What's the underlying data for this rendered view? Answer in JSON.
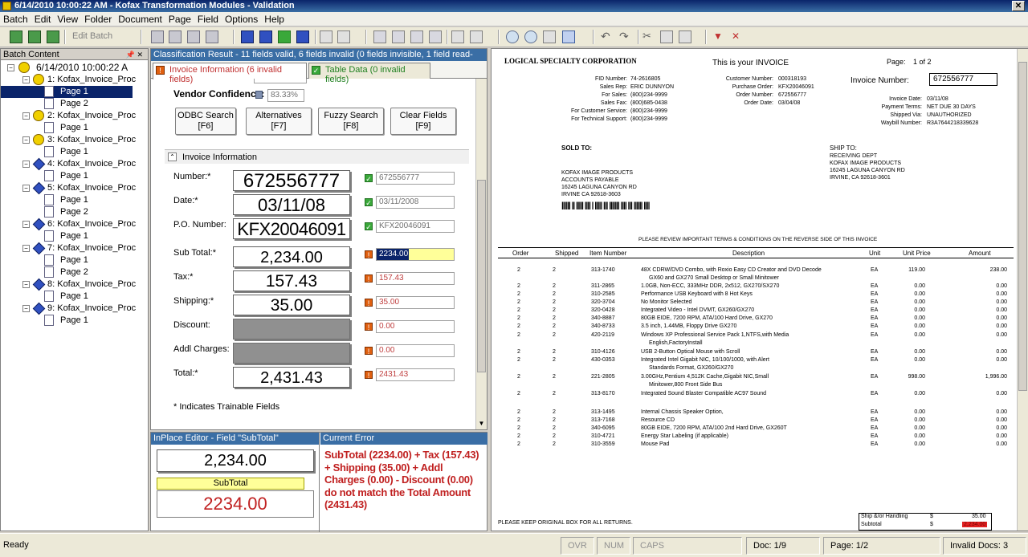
{
  "window": {
    "title": "6/14/2010 10:00:22 AM - Kofax Transformation Modules - Validation",
    "close": "✕"
  },
  "menu": [
    "Batch",
    "Edit",
    "View",
    "Folder",
    "Document",
    "Page",
    "Field",
    "Options",
    "Help"
  ],
  "toolbar": {
    "edit_batch": "Edit Batch"
  },
  "batch": {
    "title": "Batch Content",
    "pin": "📌 ✕",
    "root": "6/14/2010 10:00:22 A",
    "items": [
      {
        "label": "1: Kofax_Invoice_Proc",
        "pages": [
          "Page 1",
          "Page 2"
        ]
      },
      {
        "label": "2: Kofax_Invoice_Proc",
        "pages": [
          "Page 1"
        ]
      },
      {
        "label": "3: Kofax_Invoice_Proc",
        "pages": [
          "Page 1"
        ]
      },
      {
        "label": "4: Kofax_Invoice_Proc",
        "pages": [
          "Page 1"
        ]
      },
      {
        "label": "5: Kofax_Invoice_Proc",
        "pages": [
          "Page 1",
          "Page 2"
        ]
      },
      {
        "label": "6: Kofax_Invoice_Proc",
        "pages": [
          "Page 1"
        ]
      },
      {
        "label": "7: Kofax_Invoice_Proc",
        "pages": [
          "Page 1",
          "Page 2"
        ]
      },
      {
        "label": "8: Kofax_Invoice_Proc",
        "pages": [
          "Page 1"
        ]
      },
      {
        "label": "9: Kofax_Invoice_Proc",
        "pages": [
          "Page 1"
        ]
      }
    ]
  },
  "classification": {
    "header": "Classification Result - 11 fields valid, 6 fields invalid (0 fields invisible, 1 field read-only)",
    "tab_invoice": "Invoice Information (6 invalid fields)",
    "tab_table": "Table Data (0 invalid fields)",
    "vendor_label": "Vendor Confidence:",
    "vendor_value": "83.33%",
    "buttons": [
      {
        "l1": "ODBC Search",
        "l2": "[F6]"
      },
      {
        "l1": "Alternatives",
        "l2": "[F7]"
      },
      {
        "l1": "Fuzzy Search",
        "l2": "[F8]"
      },
      {
        "l1": "Clear Fields",
        "l2": "[F9]"
      }
    ],
    "section": "Invoice Information",
    "fields": [
      {
        "label": "Number:*",
        "snip": "672556777",
        "value": "672556777",
        "status": "ok"
      },
      {
        "label": "Date:*",
        "snip": "03/11/08",
        "value": "03/11/2008",
        "status": "ok"
      },
      {
        "label": "P.O. Number:",
        "snip": "KFX20046091",
        "value": "KFX20046091",
        "status": "ok"
      },
      {
        "label": "Sub Total:*",
        "snip": "2,234.00",
        "value": "2234.00",
        "status": "er"
      },
      {
        "label": "Tax:*",
        "snip": "157.43",
        "value": "157.43",
        "status": "er"
      },
      {
        "label": "Shipping:*",
        "snip": "35.00",
        "value": "35.00",
        "status": "er"
      },
      {
        "label": "Discount:",
        "snip": "",
        "value": "0.00",
        "status": "er"
      },
      {
        "label": "Addl Charges:",
        "snip": "",
        "value": "0.00",
        "status": "er"
      },
      {
        "label": "Total:*",
        "snip": "2,431.43",
        "value": "2431.43",
        "status": "er"
      }
    ],
    "footnote": "* Indicates Trainable Fields"
  },
  "inplace": {
    "header": "InPlace Editor - Field \"SubTotal\"",
    "snip": "2,234.00",
    "label": "SubTotal",
    "value": "2234.00"
  },
  "error": {
    "header": "Current Error",
    "text": "SubTotal (2234.00) + Tax (157.43) + Shipping (35.00) + Addl Charges (0.00) - Discount (0.00) do not match the Total Amount (2431.43)"
  },
  "invoice": {
    "company": "LOGICAL SPECIALTY CORPORATION",
    "this_is": "This is your INVOICE",
    "page_label": "Page:",
    "page_val": "1 of 2",
    "inv_num_label": "Invoice Number:",
    "inv_num": "672556777",
    "left_labels": [
      "FID Number:",
      "Sales Rep:",
      "For Sales:",
      "Sales Fax:",
      "For Customer Service:",
      "For Technical Support:"
    ],
    "left_vals": [
      "74-2616805",
      "ERIC DUNNYON",
      "(800)234-9999",
      "(800)685-0438",
      "(800)234-9999",
      "(800)234-9999"
    ],
    "mid_labels": [
      "Customer Number:",
      "Purchase Order:",
      "Order Number:",
      "Order Date:"
    ],
    "mid_vals": [
      "000318193",
      "KFX20046091",
      "672556777",
      "03/04/08"
    ],
    "right_labels": [
      "Invoice Date:",
      "Payment Terms:",
      "Shipped Via:",
      "Waybill Number:"
    ],
    "right_vals": [
      "03/11/08",
      "NET DUE 30 DAYS",
      "UNAUTHORIZED",
      "R3A7644218339628"
    ],
    "sold_to": "SOLD TO:",
    "sold_lines": [
      "KOFAX IMAGE PRODUCTS",
      "ACCOUNTS PAYABLE",
      "16245 LAGUNA CANYON RD",
      "IRVINE CA 92618-3603"
    ],
    "ship_to": "SHIP TO:",
    "ship_lines": [
      "RECEIVING DEPT",
      "KOFAX IMAGE PRODUCTS",
      "16245 LAGUNA CANYON RD",
      "IRVINE, CA 92618-3601"
    ],
    "barcode": "|||||| || ||||| |||| | ||||| ||| ||||||| |||| ||| |||||| ||||",
    "review": "PLEASE REVIEW IMPORTANT TERMS & CONDITIONS ON THE REVERSE SIDE OF THIS INVOICE",
    "cols": [
      "Order",
      "Shipped",
      "Item Number",
      "Description",
      "Unit",
      "Unit Price",
      "Amount"
    ],
    "rows": [
      [
        "2",
        "2",
        "313-1740",
        "48X CDRW/DVD Combo, with Roxio Easy CD Creator and DVD Decode",
        "EA",
        "119.00",
        "238.00"
      ],
      [
        "",
        "",
        "",
        "GX60 and GX270 Small Desktop or Small Minitower",
        "",
        "",
        ""
      ],
      [
        "2",
        "2",
        "311-2865",
        "1.0GB, Non-ECC, 333MHz DDR, 2x512, GX270/SX270",
        "EA",
        "0.00",
        "0.00"
      ],
      [
        "2",
        "2",
        "310-2585",
        "Performance USB Keyboard with 8 Hot Keys",
        "EA",
        "0.00",
        "0.00"
      ],
      [
        "2",
        "2",
        "320-3704",
        "No Monitor Selected",
        "EA",
        "0.00",
        "0.00"
      ],
      [
        "2",
        "2",
        "320-0428",
        "Integrated Video - Intel DVMT, GX260/GX270",
        "EA",
        "0.00",
        "0.00"
      ],
      [
        "2",
        "2",
        "340-8887",
        "80GB EIDE, 7200 RPM, ATA/100 Hard Drive, GX270",
        "EA",
        "0.00",
        "0.00"
      ],
      [
        "2",
        "2",
        "340-8733",
        "3.5 inch, 1.44MB, Floppy Drive GX270",
        "EA",
        "0.00",
        "0.00"
      ],
      [
        "2",
        "2",
        "420-2119",
        "Windows XP Professional Service Pack 1,NTFS,with Media",
        "EA",
        "0.00",
        "0.00"
      ],
      [
        "",
        "",
        "",
        "English,FactoryInstall",
        "",
        "",
        ""
      ],
      [
        "2",
        "2",
        "310-4126",
        "USB 2-Button Optical Mouse with Scroll",
        "EA",
        "0.00",
        "0.00"
      ],
      [
        "2",
        "2",
        "430-0353",
        "Integrated Intel Gigabit NIC, 10/100/1000, with Alert",
        "EA",
        "0.00",
        "0.00"
      ],
      [
        "",
        "",
        "",
        "Standards Format, GX260/GX270",
        "",
        "",
        ""
      ],
      [
        "2",
        "2",
        "221-2805",
        "3.00GHz,Pentium 4,512K Cache,Gigabit NIC,Small",
        "EA",
        "998.00",
        "1,996.00"
      ],
      [
        "",
        "",
        "",
        "Minitower,800 Front Side Bus",
        "",
        "",
        ""
      ],
      [
        "2",
        "2",
        "313-8170",
        "Integrated Sound Blaster Compatible AC97 Sound",
        "EA",
        "0.00",
        "0.00"
      ],
      [
        "",
        "",
        "",
        "",
        "",
        "",
        ""
      ],
      [
        "2",
        "2",
        "313-1495",
        "Internal Chassis Speaker Option,",
        "EA",
        "0.00",
        "0.00"
      ],
      [
        "2",
        "2",
        "313-7168",
        "Resource CD",
        "EA",
        "0.00",
        "0.00"
      ],
      [
        "2",
        "2",
        "340-6095",
        "80GB EIDE, 7200 RPM, ATA/100 2nd Hard Drive, GX260T",
        "EA",
        "0.00",
        "0.00"
      ],
      [
        "2",
        "2",
        "310-4721",
        "Energy Star Labeling (if applicable)",
        "EA",
        "0.00",
        "0.00"
      ],
      [
        "2",
        "2",
        "310-3559",
        "Mouse Pad",
        "EA",
        "0.00",
        "0.00"
      ]
    ],
    "keep_box": "PLEASE KEEP ORIGINAL BOX FOR ALL RETURNS.",
    "ship_label": "Ship &/or Handling",
    "ship_cur": "$",
    "ship_val": "35.00",
    "sub_label": "Subtotal",
    "sub_cur": "$",
    "sub_val": "2,234.00"
  },
  "status": {
    "ready": "Ready",
    "ovr": "OVR",
    "num": "NUM",
    "caps": "CAPS",
    "doc": "Doc: 1/9",
    "page": "Page: 1/2",
    "invalid": "Invalid Docs: 3"
  }
}
